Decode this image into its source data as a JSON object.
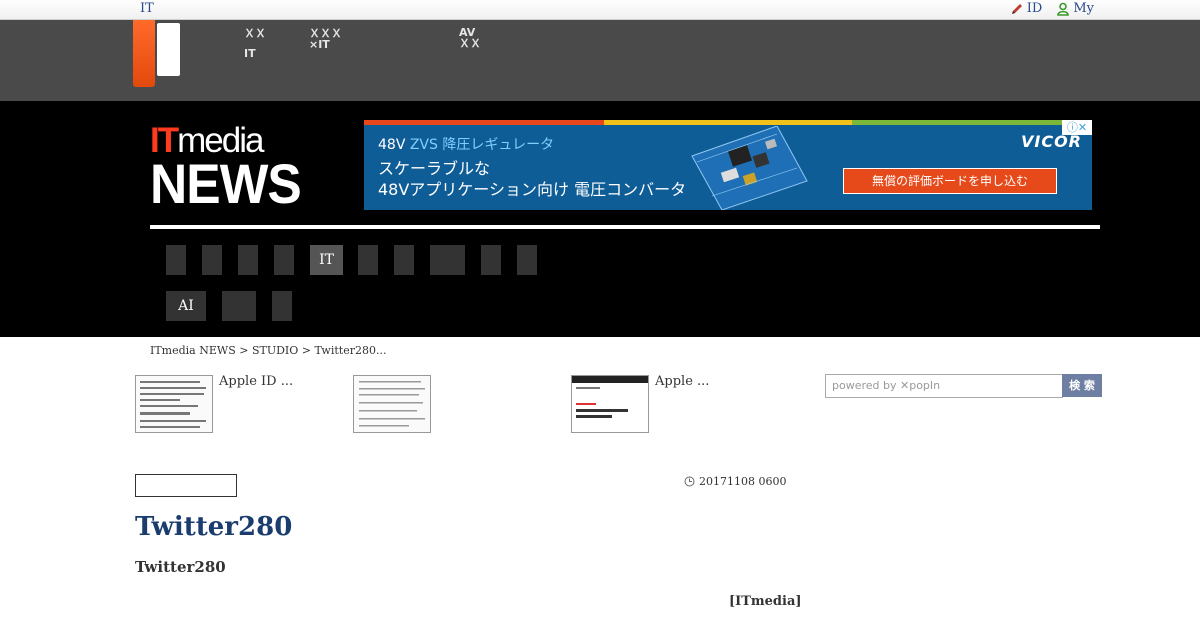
{
  "topbar": {
    "brand": "IT",
    "links": [
      {
        "label": "ID",
        "icon": "pencil-icon"
      },
      {
        "label": "My",
        "icon": "user-icon"
      }
    ]
  },
  "gnav": {
    "items": [
      {
        "line1": "ＸＸ",
        "line2": "IT"
      },
      {
        "line1": "ＸＸＸ",
        "line2": "×IT"
      },
      {
        "line1": "AV",
        "line2": "ＸＸ"
      }
    ]
  },
  "header": {
    "logo": {
      "it": "IT",
      "media": "media",
      "news": "NEWS"
    },
    "ad": {
      "line1_prefix": "48V ",
      "line1_accent": "ZVS 降圧レギュレータ",
      "line2a": "スケーラブルな",
      "line2b": "48Vアプリケーション向け 電圧コンバータ",
      "brand": "VICOR",
      "cta": "無償の評価ボードを申し込む",
      "adchoice": "ⓘ✕",
      "colors": {
        "background": "#0f5d97",
        "cta": "#e64a1b"
      }
    },
    "categories_row1": [
      "",
      "",
      "",
      "",
      "IT",
      "",
      "",
      "",
      "",
      ""
    ],
    "categories_row2": [
      "AI",
      "",
      ""
    ]
  },
  "breadcrumb": "ITmedia NEWS > STUDIO > Twitter280...",
  "related": [
    {
      "title": "Apple ID ..."
    },
    {
      "title": ""
    },
    {
      "title": "Apple ..."
    }
  ],
  "search": {
    "placeholder": "powered by ✕popIn",
    "button": "検 索"
  },
  "article": {
    "date": "20171108 0600",
    "title": "Twitter280",
    "subtitle": "Twitter280",
    "byline": "[ITmedia]"
  }
}
